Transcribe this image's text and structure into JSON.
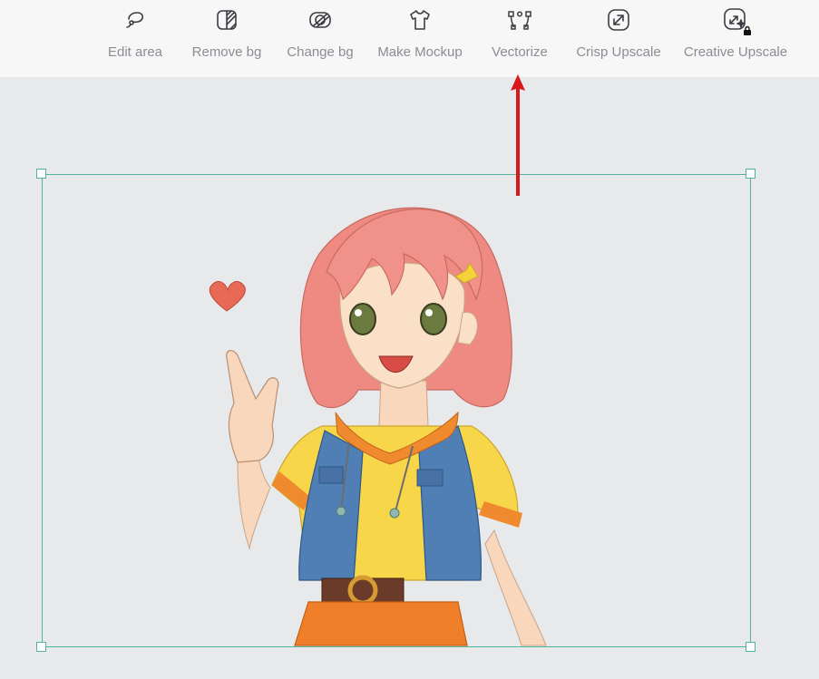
{
  "toolbar": {
    "tools": [
      {
        "label": "Edit area",
        "icon": "lasso-icon"
      },
      {
        "label": "Remove bg",
        "icon": "remove-bg-icon"
      },
      {
        "label": "Change bg",
        "icon": "change-bg-icon"
      },
      {
        "label": "Make Mockup",
        "icon": "tshirt-icon"
      },
      {
        "label": "Vectorize",
        "icon": "vector-nodes-icon"
      },
      {
        "label": "Crisp Upscale",
        "icon": "expand-arrow-icon"
      },
      {
        "label": "Creative Upscale",
        "icon": "sparkle-upscale-icon",
        "locked": true
      }
    ]
  },
  "colors": {
    "selection": "#4fb3a0",
    "arrow": "#d7191c",
    "canvas_bg": "#e8e9eb",
    "toolbar_bg": "#f7f7f8",
    "label": "#8a8d93"
  }
}
